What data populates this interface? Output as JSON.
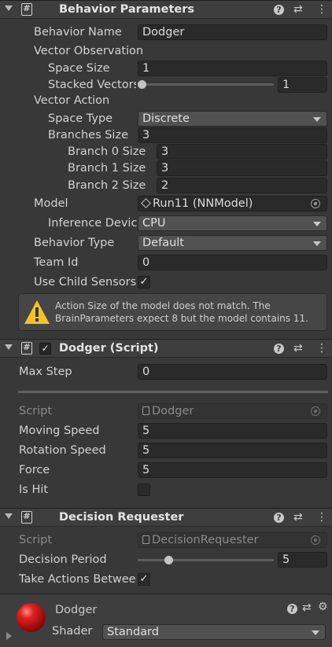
{
  "behavior_parameters": {
    "title": "Behavior Parameters",
    "behavior_name_label": "Behavior Name",
    "behavior_name_value": "Dodger",
    "vector_observation_label": "Vector Observation",
    "space_size_label": "Space Size",
    "space_size_value": "1",
    "stacked_vectors_label": "Stacked Vectors",
    "stacked_vectors_value": "1",
    "vector_action_label": "Vector Action",
    "space_type_label": "Space Type",
    "space_type_value": "Discrete",
    "branches_size_label": "Branches Size",
    "branches_size_value": "3",
    "branches": [
      {
        "label": "Branch 0 Size",
        "value": "3"
      },
      {
        "label": "Branch 1 Size",
        "value": "3"
      },
      {
        "label": "Branch 2 Size",
        "value": "2"
      }
    ],
    "model_label": "Model",
    "model_value": "Run11 (NNModel)",
    "inference_device_label": "Inference Device",
    "inference_device_value": "CPU",
    "behavior_type_label": "Behavior Type",
    "behavior_type_value": "Default",
    "team_id_label": "Team Id",
    "team_id_value": "0",
    "use_child_sensors_label": "Use Child Sensors",
    "use_child_sensors_checked": true,
    "warning_line1": "Action Size of the model does not match. The",
    "warning_line2": "BrainParameters expect 8 but the model contains 11."
  },
  "dodger_script": {
    "title": "Dodger (Script)",
    "enabled": true,
    "max_step_label": "Max Step",
    "max_step_value": "0",
    "script_label": "Script",
    "script_value": "Dodger",
    "moving_speed_label": "Moving Speed",
    "moving_speed_value": "5",
    "rotation_speed_label": "Rotation Speed",
    "rotation_speed_value": "5",
    "force_label": "Force",
    "force_value": "5",
    "is_hit_label": "Is Hit",
    "is_hit_checked": false
  },
  "decision_requester": {
    "title": "Decision Requester",
    "script_label": "Script",
    "script_value": "DecisionRequester",
    "decision_period_label": "Decision Period",
    "decision_period_value": "5",
    "take_actions_label": "Take Actions Between Decisions",
    "take_actions_checked": true
  },
  "material": {
    "name": "Dodger",
    "shader_label": "Shader",
    "shader_value": "Standard"
  },
  "icons": {
    "foldout": "chevron-down-icon",
    "help": "help-icon",
    "presets": "sliders-icon",
    "menu": "kebab-menu-icon",
    "warning": "warning-triangle-icon",
    "gear": "gear-icon"
  },
  "colors": {
    "panel_bg": "#383838",
    "header_bg": "#3e3e3e",
    "field_bg": "#2a2a2a",
    "warning_yellow": "#f2c12e",
    "material_red": "#c41414"
  }
}
